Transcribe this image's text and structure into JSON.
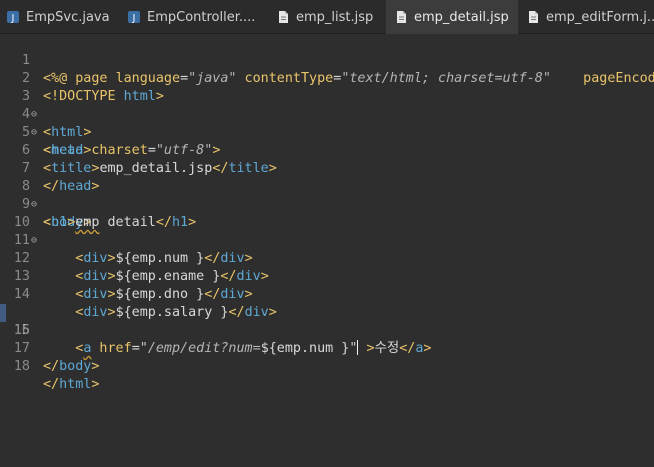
{
  "tabs": [
    {
      "label": "EmpSvc.java",
      "icon": "java-file-icon",
      "active": false
    },
    {
      "label": "EmpController....",
      "icon": "java-file-icon",
      "active": false
    },
    {
      "label": "emp_list.jsp",
      "icon": "jsp-file-icon",
      "active": false
    },
    {
      "label": "emp_detail.jsp",
      "icon": "jsp-file-icon",
      "active": true,
      "close": "×"
    },
    {
      "label": "emp_editForm.j...",
      "icon": "jsp-file-icon",
      "active": false
    }
  ],
  "lines": [
    {
      "n": "1",
      "fold": ""
    },
    {
      "n": "2",
      "fold": ""
    },
    {
      "n": "3",
      "fold": "⊖"
    },
    {
      "n": "4",
      "fold": "⊖"
    },
    {
      "n": "5",
      "fold": ""
    },
    {
      "n": "6",
      "fold": ""
    },
    {
      "n": "7",
      "fold": ""
    },
    {
      "n": "8",
      "fold": "⊖"
    },
    {
      "n": "9",
      "fold": ""
    },
    {
      "n": "10",
      "fold": "⊖"
    },
    {
      "n": "11",
      "fold": ""
    },
    {
      "n": "12",
      "fold": ""
    },
    {
      "n": "13",
      "fold": ""
    },
    {
      "n": "14",
      "fold": ""
    },
    {
      "n": "15",
      "fold": ""
    },
    {
      "n": "16",
      "fold": ""
    },
    {
      "n": "17",
      "fold": ""
    },
    {
      "n": "18",
      "fold": ""
    }
  ],
  "code": {
    "l1": {
      "open": "<%@ ",
      "page": "page ",
      "a1": "language",
      "eq1": "=",
      "v1": "\"java\"",
      "a2": " contentType",
      "eq2": "=",
      "v2": "\"text/html; charset=utf-8\"",
      "a3": "    pageEncodi"
    },
    "l2": {
      "text": "<!DOCTYPE ",
      "kw": "html",
      ">": ">"
    },
    "l3": {
      "lt": "<",
      "tag": "html",
      "gt": ">"
    },
    "l4": {
      "lt": "<",
      "tag": "head",
      "gt": ">"
    },
    "l5": {
      "lt": "<",
      "tag": "meta",
      "a": " charset",
      "eq": "=",
      "v": "\"utf-8\"",
      "gt": ">"
    },
    "l6": {
      "lt": "<",
      "tag": "title",
      "gt": ">",
      "text": "emp_detail.jsp",
      "lt2": "</",
      "tag2": "title",
      "gt2": ">"
    },
    "l7": {
      "lt": "</",
      "tag": "head",
      "gt": ">"
    },
    "l8": {
      "lt": "<",
      "tag": "body",
      "gt": ">"
    },
    "l9": {
      "lt": "<",
      "tag": "h1",
      "gt": ">",
      "text1": "emp",
      "text2": " detail",
      "lt2": "</",
      "tag2": "h1",
      "gt2": ">"
    },
    "l11": {
      "indent": "    ",
      "lt": "<",
      "tag": "div",
      "gt": ">",
      "text": "${emp.num }",
      "lt2": "</",
      "tag2": "div",
      "gt2": ">"
    },
    "l12": {
      "indent": "    ",
      "lt": "<",
      "tag": "div",
      "gt": ">",
      "text": "${emp.ename }",
      "lt2": "</",
      "tag2": "div",
      "gt2": ">"
    },
    "l13": {
      "indent": "    ",
      "lt": "<",
      "tag": "div",
      "gt": ">",
      "text": "${emp.dno }",
      "lt2": "</",
      "tag2": "div",
      "gt2": ">"
    },
    "l14": {
      "indent": "    ",
      "lt": "<",
      "tag": "div",
      "gt": ">",
      "text": "${emp.salary }",
      "lt2": "</",
      "tag2": "div",
      "gt2": ">"
    },
    "l15": {
      "indent": "    ",
      "lt": "<",
      "tag": "a",
      "a": " href",
      "eq": "=",
      "q1": "\"",
      "v": "/emp/edit?num=",
      "el": "${emp.num }",
      "q2": "\"",
      "gt": " >",
      "text": "수정",
      "lt2": "</",
      "tag2": "a",
      "gt2": ">"
    },
    "l17": {
      "lt": "</",
      "tag": "body",
      "gt": ">"
    },
    "l18": {
      "lt": "</",
      "tag": "html",
      "gt": ">"
    }
  },
  "colors": {
    "background": "#2e2e2e",
    "tag": "#5fa8d3",
    "attribute": "#e9c46a",
    "string": "#b5b5b5"
  }
}
